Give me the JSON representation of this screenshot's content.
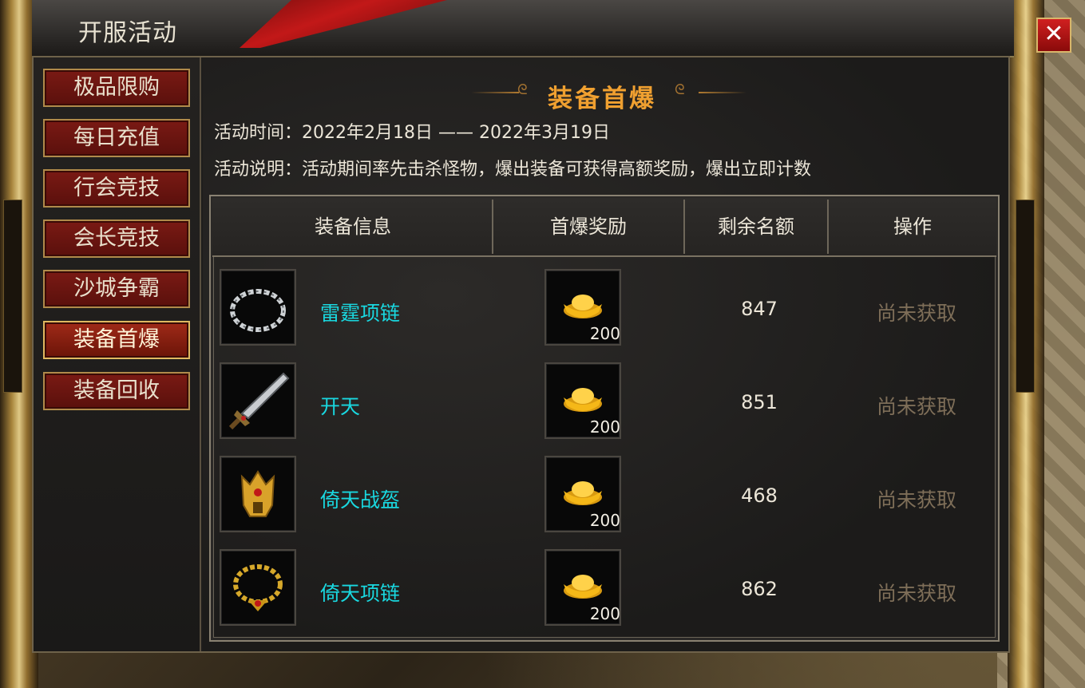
{
  "window": {
    "title": "开服活动",
    "close_symbol": "✕"
  },
  "sidebar": {
    "items": [
      {
        "label": "极品限购",
        "active": false
      },
      {
        "label": "每日充值",
        "active": false
      },
      {
        "label": "行会竞技",
        "active": false
      },
      {
        "label": "会长竞技",
        "active": false
      },
      {
        "label": "沙城争霸",
        "active": false
      },
      {
        "label": "装备首爆",
        "active": true
      },
      {
        "label": "装备回收",
        "active": false
      }
    ]
  },
  "main": {
    "section_title": "装备首爆",
    "time_label": "活动时间：2022年2月18日 —— 2022年3月19日",
    "desc_label": "活动说明：活动期间率先击杀怪物，爆出装备可获得高额奖励，爆出立即计数"
  },
  "table": {
    "headers": [
      "装备信息",
      "首爆奖励",
      "剩余名额",
      "操作"
    ],
    "rows": [
      {
        "item_icon": "chain-necklace-icon",
        "name": "雷霆项链",
        "reward_icon": "gold-ingot-icon",
        "reward_count": "200",
        "remaining": "847",
        "status": "尚未获取"
      },
      {
        "item_icon": "sword-icon",
        "name": "开天",
        "reward_icon": "gold-ingot-icon",
        "reward_count": "200",
        "remaining": "851",
        "status": "尚未获取"
      },
      {
        "item_icon": "golden-helmet-icon",
        "name": "倚天战盔",
        "reward_icon": "gold-ingot-icon",
        "reward_count": "200",
        "remaining": "468",
        "status": "尚未获取"
      },
      {
        "item_icon": "gold-necklace-icon",
        "name": "倚天项链",
        "reward_icon": "gold-ingot-icon",
        "reward_count": "200",
        "remaining": "862",
        "status": "尚未获取"
      }
    ]
  },
  "colors": {
    "item_name": "#19d8e0",
    "status_text": "#7e6e58",
    "section_title": "#f0a030",
    "button_red": "#7a1a14"
  }
}
